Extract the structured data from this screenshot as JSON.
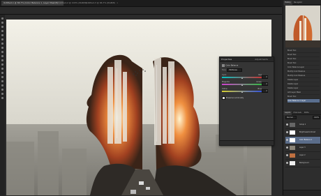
{
  "tabs": [
    {
      "label": "Untitled-1 @ 66.7% (Color Balance 1, Layer Mask/8)",
      "active": true
    },
    {
      "label": "Untitled-2 @ 100% (RGB/8)",
      "active": false
    },
    {
      "label": "Untitled-3 @ 66.7% (RGB/8)",
      "active": false
    }
  ],
  "properties": {
    "title": "Properties",
    "menu": "Adjustments",
    "adjustment": "Color Balance",
    "tone": "Midtones",
    "sliders": [
      {
        "left": "Cyan",
        "right": "Red",
        "value": "0",
        "colors": [
          "#00c8c8",
          "#d03030"
        ],
        "pos": 0.5
      },
      {
        "left": "Magenta",
        "right": "Green",
        "value": "0",
        "colors": [
          "#d040d0",
          "#30c040"
        ],
        "pos": 0.5
      },
      {
        "left": "Yellow",
        "right": "Blue",
        "value": "0",
        "colors": [
          "#d8d030",
          "#3050e0"
        ],
        "pos": 0.5
      }
    ],
    "preserve": "Preserve Luminosity"
  },
  "right": {
    "tabs": [
      "History",
      "Navigator"
    ],
    "history": [
      "Brush Tool",
      "Brush Tool",
      "Brush Tool",
      "Brush Tool",
      "Color Balance Layer",
      "Modify Color Balance",
      "Modify Color Balance",
      "Delete Layer",
      "Delete Layer",
      "Delete Layer",
      "Add Layer Mask",
      "Brush Tool",
      "Color Balance 1 Layer"
    ],
    "layer_tabs": [
      "Layers",
      "Channels",
      "Paths"
    ],
    "blend": "Normal",
    "opacity": "100%",
    "layers": [
      "Group 1",
      "Brightness/Contrast",
      "Color Balance 1",
      "Layer 3",
      "Layer 2",
      "Background"
    ]
  }
}
